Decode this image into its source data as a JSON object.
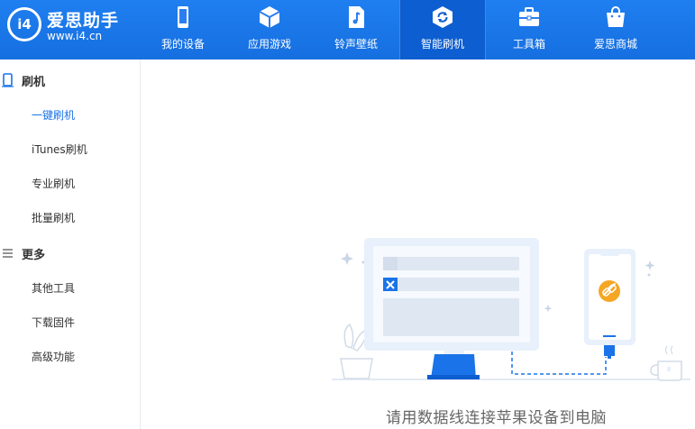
{
  "app": {
    "logo_badge": "i4",
    "title": "爱思助手",
    "url": "www.i4.cn"
  },
  "nav": [
    {
      "label": "我的设备",
      "icon": "phone-icon",
      "active": false
    },
    {
      "label": "应用游戏",
      "icon": "cube-icon",
      "active": false
    },
    {
      "label": "铃声壁纸",
      "icon": "music-file-icon",
      "active": false
    },
    {
      "label": "智能刷机",
      "icon": "refresh-icon",
      "active": true
    },
    {
      "label": "工具箱",
      "icon": "toolbox-icon",
      "active": false
    },
    {
      "label": "爱思商城",
      "icon": "shopping-bag-icon",
      "active": false
    }
  ],
  "sidebar": {
    "sections": [
      {
        "label": "刷机",
        "icon": "phone-outline-icon",
        "items": [
          {
            "label": "一键刷机",
            "active": true
          },
          {
            "label": "iTunes刷机",
            "active": false
          },
          {
            "label": "专业刷机",
            "active": false
          },
          {
            "label": "批量刷机",
            "active": false
          }
        ]
      },
      {
        "label": "更多",
        "icon": "menu-lines-icon",
        "items": [
          {
            "label": "其他工具",
            "active": false
          },
          {
            "label": "下载固件",
            "active": false
          },
          {
            "label": "高级功能",
            "active": false
          }
        ]
      }
    ]
  },
  "main": {
    "caption": "请用数据线连接苹果设备到电脑"
  },
  "colors": {
    "topbar": "#1a73e8",
    "active_nav": "#0d5ed0",
    "accent": "#1a73e8",
    "illustration_light": "#e8f0fb",
    "link_orange": "#f5a623"
  }
}
